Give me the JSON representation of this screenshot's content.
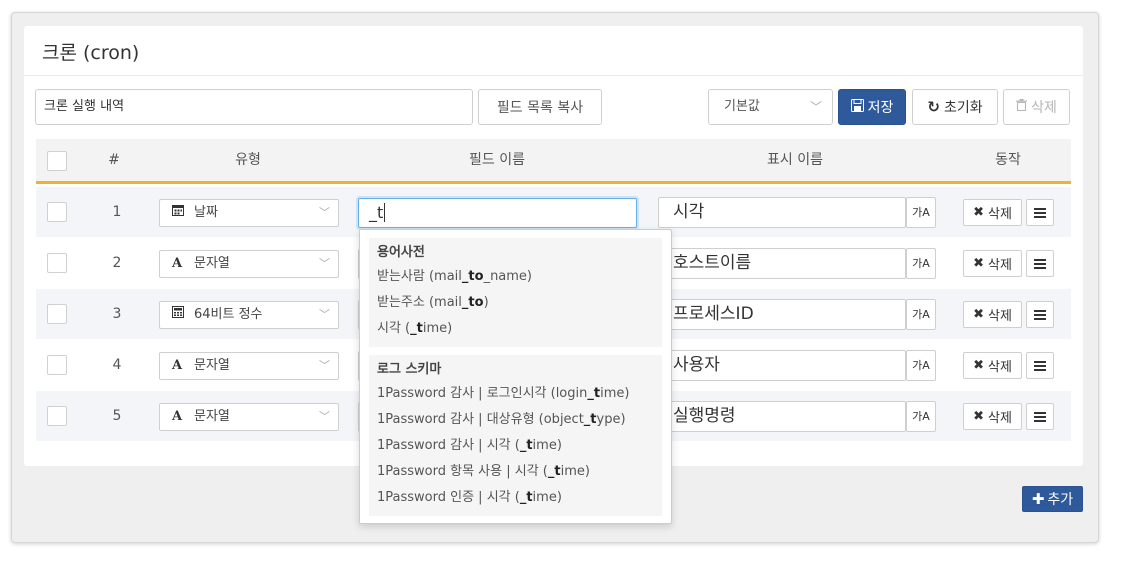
{
  "panel": {
    "title": "크론 (cron)"
  },
  "toolbar": {
    "name_value": "크론 실행 내역",
    "copy_fields_label": "필드 목록 복사",
    "preset_value": "기본값",
    "save_label": "저장",
    "reset_label": "초기화",
    "delete_label": "삭제",
    "add_label": "추가"
  },
  "table": {
    "headers": {
      "num": "#",
      "type": "유형",
      "field_name": "필드 이름",
      "display_name": "표시 이름",
      "action": "동작"
    },
    "rows": [
      {
        "num": "1",
        "type_icon": "calendar-icon",
        "type": "날짜",
        "field": "_t",
        "display": "시각"
      },
      {
        "num": "2",
        "type_icon": "text-icon",
        "type": "문자열",
        "field": "",
        "display": "호스트이름"
      },
      {
        "num": "3",
        "type_icon": "calculator-icon",
        "type": "64비트 정수",
        "field": "",
        "display": "프로세스ID"
      },
      {
        "num": "4",
        "type_icon": "text-icon",
        "type": "문자열",
        "field": "",
        "display": "사용자"
      },
      {
        "num": "5",
        "type_icon": "text-icon",
        "type": "문자열",
        "field": "",
        "display": "실행명령"
      }
    ],
    "row_delete_label": "삭제",
    "translate_label": "가A"
  },
  "autocomplete": {
    "groups": [
      {
        "title": "용어사전",
        "items": [
          [
            "받는사람 (mail",
            "_to",
            "_name)"
          ],
          [
            "받는주소 (mail",
            "_to",
            ")"
          ],
          [
            "시각 (",
            "_t",
            "ime)"
          ]
        ]
      },
      {
        "title": "로그 스키마",
        "items": [
          [
            "1Password 감사 | 로그인시각 (login",
            "_t",
            "ime)"
          ],
          [
            "1Password 감사 | 대상유형 (object",
            "_t",
            "ype)"
          ],
          [
            "1Password 감사 | 시각 (",
            "_t",
            "ime)"
          ],
          [
            "1Password 항목 사용 | 시각 (",
            "_t",
            "ime)"
          ],
          [
            "1Password 인증 | 시각 (",
            "_t",
            "ime)"
          ]
        ]
      }
    ]
  },
  "colors": {
    "primary": "#2e5a9c",
    "header_accent": "#f0b030"
  }
}
